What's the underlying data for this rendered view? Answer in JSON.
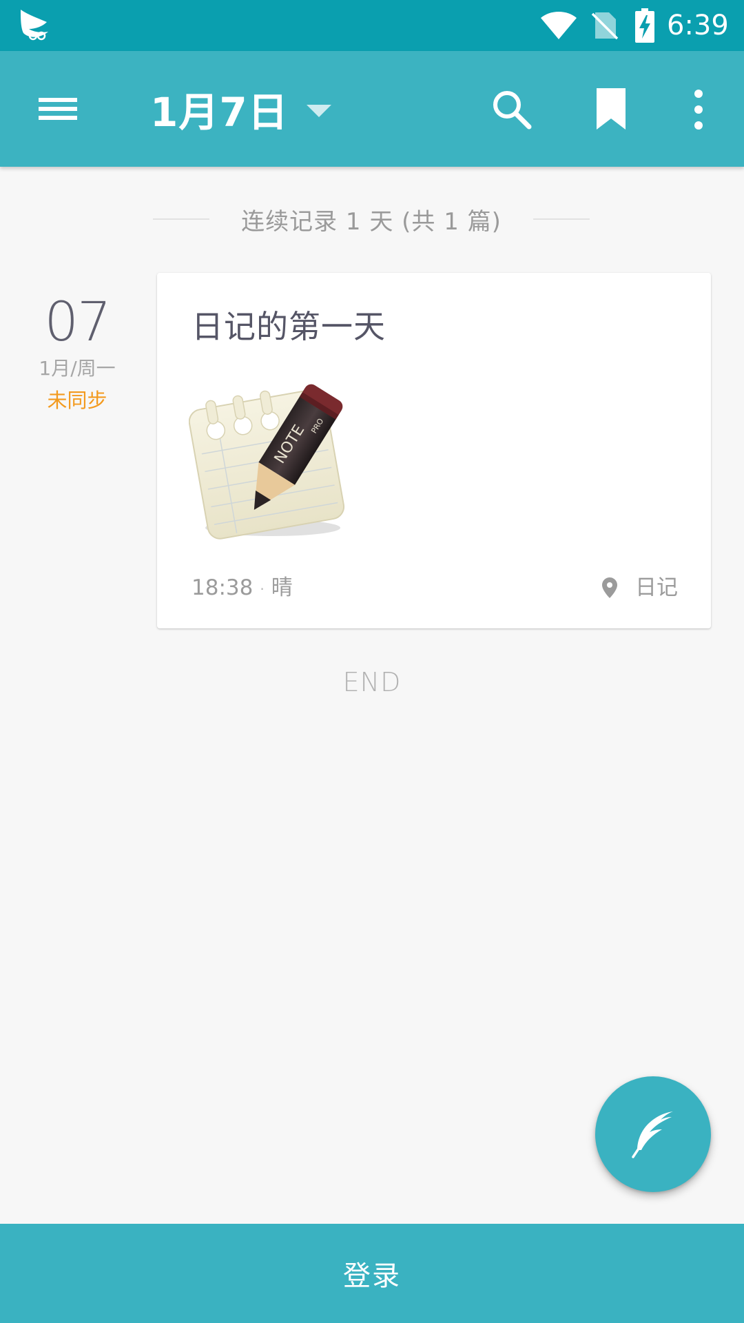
{
  "status_bar": {
    "time": "6:39",
    "icons": [
      "app-notification-icon",
      "wifi-icon",
      "no-sim-icon",
      "battery-charging-icon"
    ]
  },
  "app_bar": {
    "date_title": "1月7日",
    "icons": [
      "menu-icon",
      "dropdown-arrow-icon",
      "search-icon",
      "bookmark-icon",
      "more-vert-icon"
    ]
  },
  "summary": {
    "text": "连续记录 1 天 (共 1 篇)"
  },
  "entry": {
    "day_number": "07",
    "day_sub": "1月/周一",
    "sync_status": "未同步",
    "title": "日记的第一天",
    "time": "18:38",
    "separator": "·",
    "weather": "晴",
    "location_label": "日记",
    "thumbnail_lettering": [
      "NOTE",
      "PRO"
    ]
  },
  "end_label": "END",
  "fab": {
    "icon": "feather-icon"
  },
  "login": {
    "label": "登录"
  },
  "colors": {
    "status_bar": "#0a9faf",
    "app_bar": "#3cb3c1",
    "accent": "#3ab2c1",
    "background": "#f7f7f7",
    "sync_warning": "#f39a1e"
  }
}
